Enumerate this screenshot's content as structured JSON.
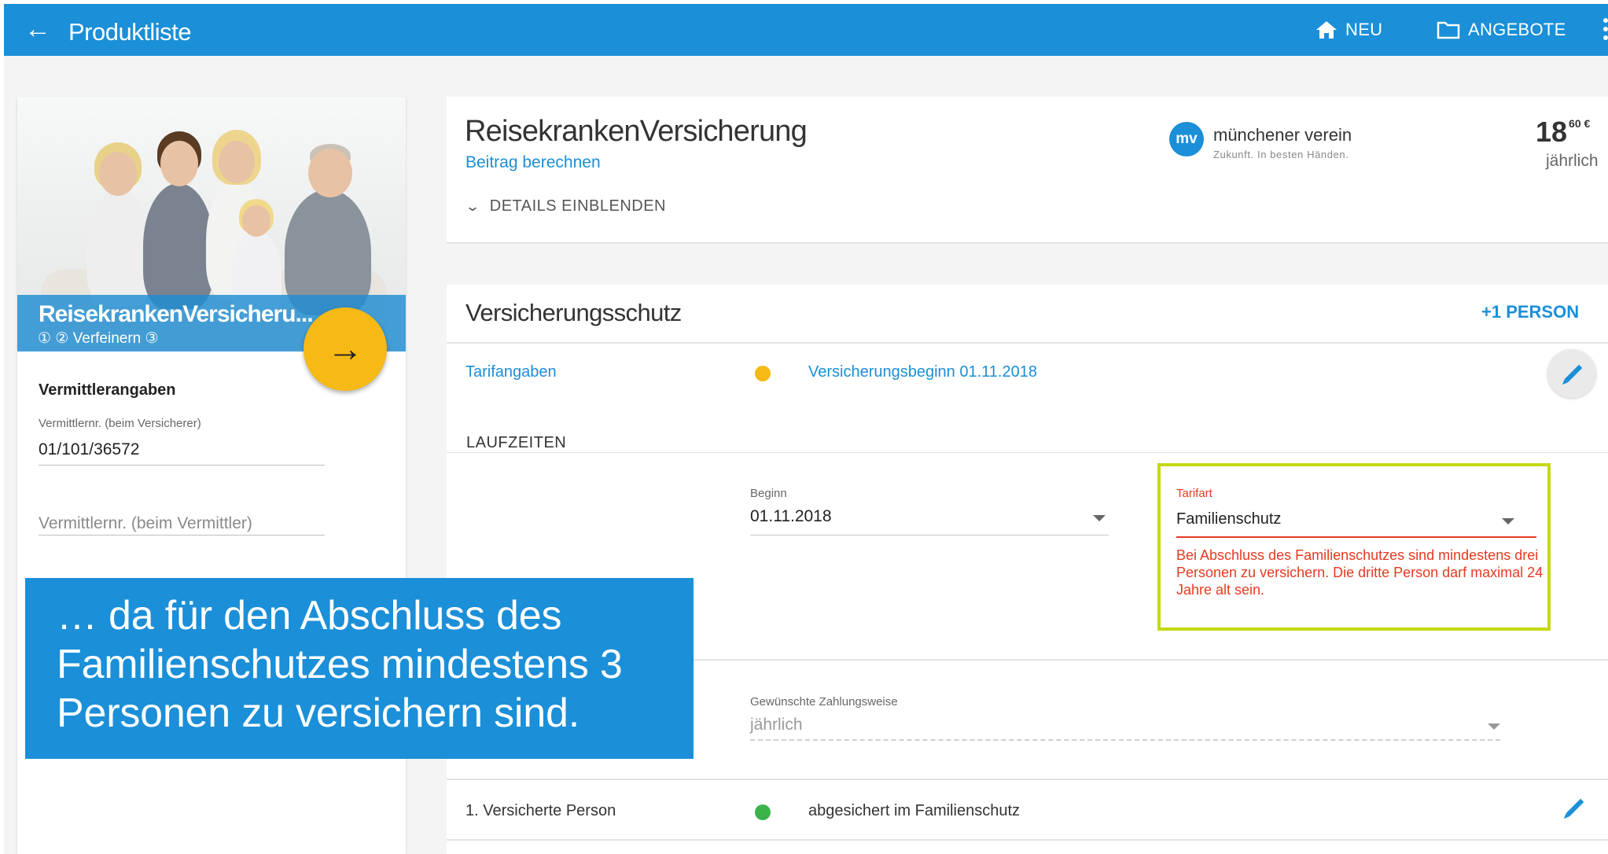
{
  "appbar": {
    "title": "Produktliste",
    "nav": [
      {
        "label": "NEU",
        "icon": "home-icon"
      },
      {
        "label": "ANGEBOTE",
        "icon": "folder-icon"
      }
    ]
  },
  "left_card": {
    "product_name": "ReisekrankenVersicheru...",
    "steps": "① ② Verfeinern ③",
    "section_title": "Vermittlerangaben",
    "field1_label": "Vermittlernr. (beim Versicherer)",
    "field1_value": "01/101/36572",
    "field2_placeholder": "Vermittlernr. (beim Vermittler)"
  },
  "product_panel": {
    "title": "ReisekrankenVersicherung",
    "link": "Beitrag berechnen",
    "details_toggle": "DETAILS EINBLENDEN",
    "insurer": {
      "logo_mark": "mv",
      "name": "münchener verein",
      "tagline": "Zukunft. In besten Händen."
    },
    "price": {
      "main": "18",
      "cents": "60 €",
      "period": "jährlich"
    }
  },
  "insurance_panel": {
    "title": "Versicherungsschutz",
    "add_person": "+1  PERSON",
    "tarif_link": "Tarifangaben",
    "tarif_status_color": "#f6b915",
    "begin_link": "Versicherungsbeginn 01.11.2018",
    "laufzeiten": "LAUFZEITEN",
    "begin_label": "Beginn",
    "begin_value": "01.11.2018",
    "tarifart_label": "Tarifart",
    "tarifart_value": "Familienschutz",
    "tarifart_error": "Bei Abschluss des Familienschutzes sind mindestens drei Personen zu versichern. Die dritte Person darf maximal 24 Jahre alt sein.",
    "zahlungsweise_label": "Gewünschte Zahlungsweise",
    "zahlungsweise_value": "jährlich",
    "person1_label": "1. Versicherte Person",
    "person1_status_color": "#3bb34a",
    "person1_status": "abgesichert im Familienschutz"
  },
  "callout": {
    "line1": "… da für den Abschluss des",
    "line2": "Familienschutzes mindestens 3",
    "line3": "Personen zu versichern sind."
  },
  "colors": {
    "primary": "#1b8fd8",
    "accent": "#f6b915",
    "error": "#e53a22",
    "highlight": "#c5d916"
  }
}
